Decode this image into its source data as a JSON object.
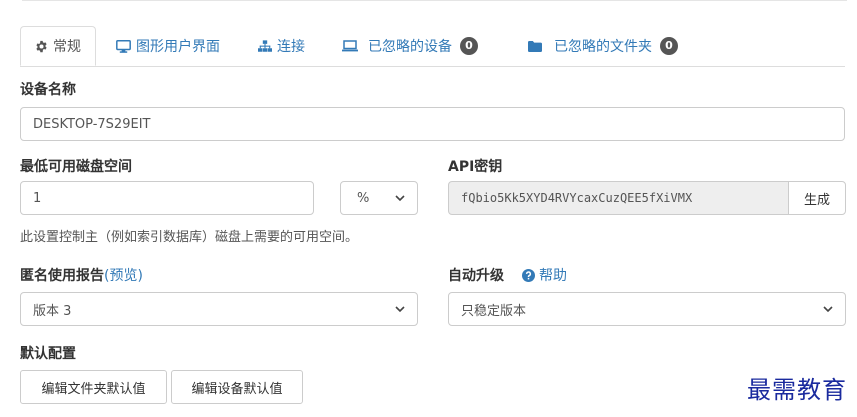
{
  "tabs": [
    {
      "label": "常规",
      "icon": "gear-icon"
    },
    {
      "label": "图形用户界面",
      "icon": "desktop-icon"
    },
    {
      "label": "连接",
      "icon": "sitemap-icon"
    },
    {
      "label": "已忽略的设备",
      "icon": "laptop-icon",
      "badge": "0"
    },
    {
      "label": "已忽略的文件夹",
      "icon": "folder-icon",
      "badge": "0"
    }
  ],
  "device_name": {
    "label": "设备名称",
    "value": "DESKTOP-7S29EIT"
  },
  "min_disk": {
    "label": "最低可用磁盘空间",
    "value": "1",
    "unit": "%",
    "help_text": "此设置控制主（例如索引数据库）磁盘上需要的可用空间。"
  },
  "api_key": {
    "label": "API密钥",
    "value": "fQbio5Kk5XYD4RVYcaxCuzQEE5fXiVMX",
    "generate_label": "生成"
  },
  "usage_report": {
    "label": "匿名使用报告",
    "preview_label": "(预览)",
    "value": "版本 3"
  },
  "auto_upgrade": {
    "label": "自动升级",
    "help_label": "帮助",
    "value": "只稳定版本"
  },
  "default_config": {
    "label": "默认配置",
    "edit_folder_defaults": "编辑文件夹默认值",
    "edit_device_defaults": "编辑设备默认值"
  },
  "watermark": "最需教育",
  "colors": {
    "link": "#337ab7",
    "badge": "#555555",
    "watermark": "#1a2a9e"
  }
}
